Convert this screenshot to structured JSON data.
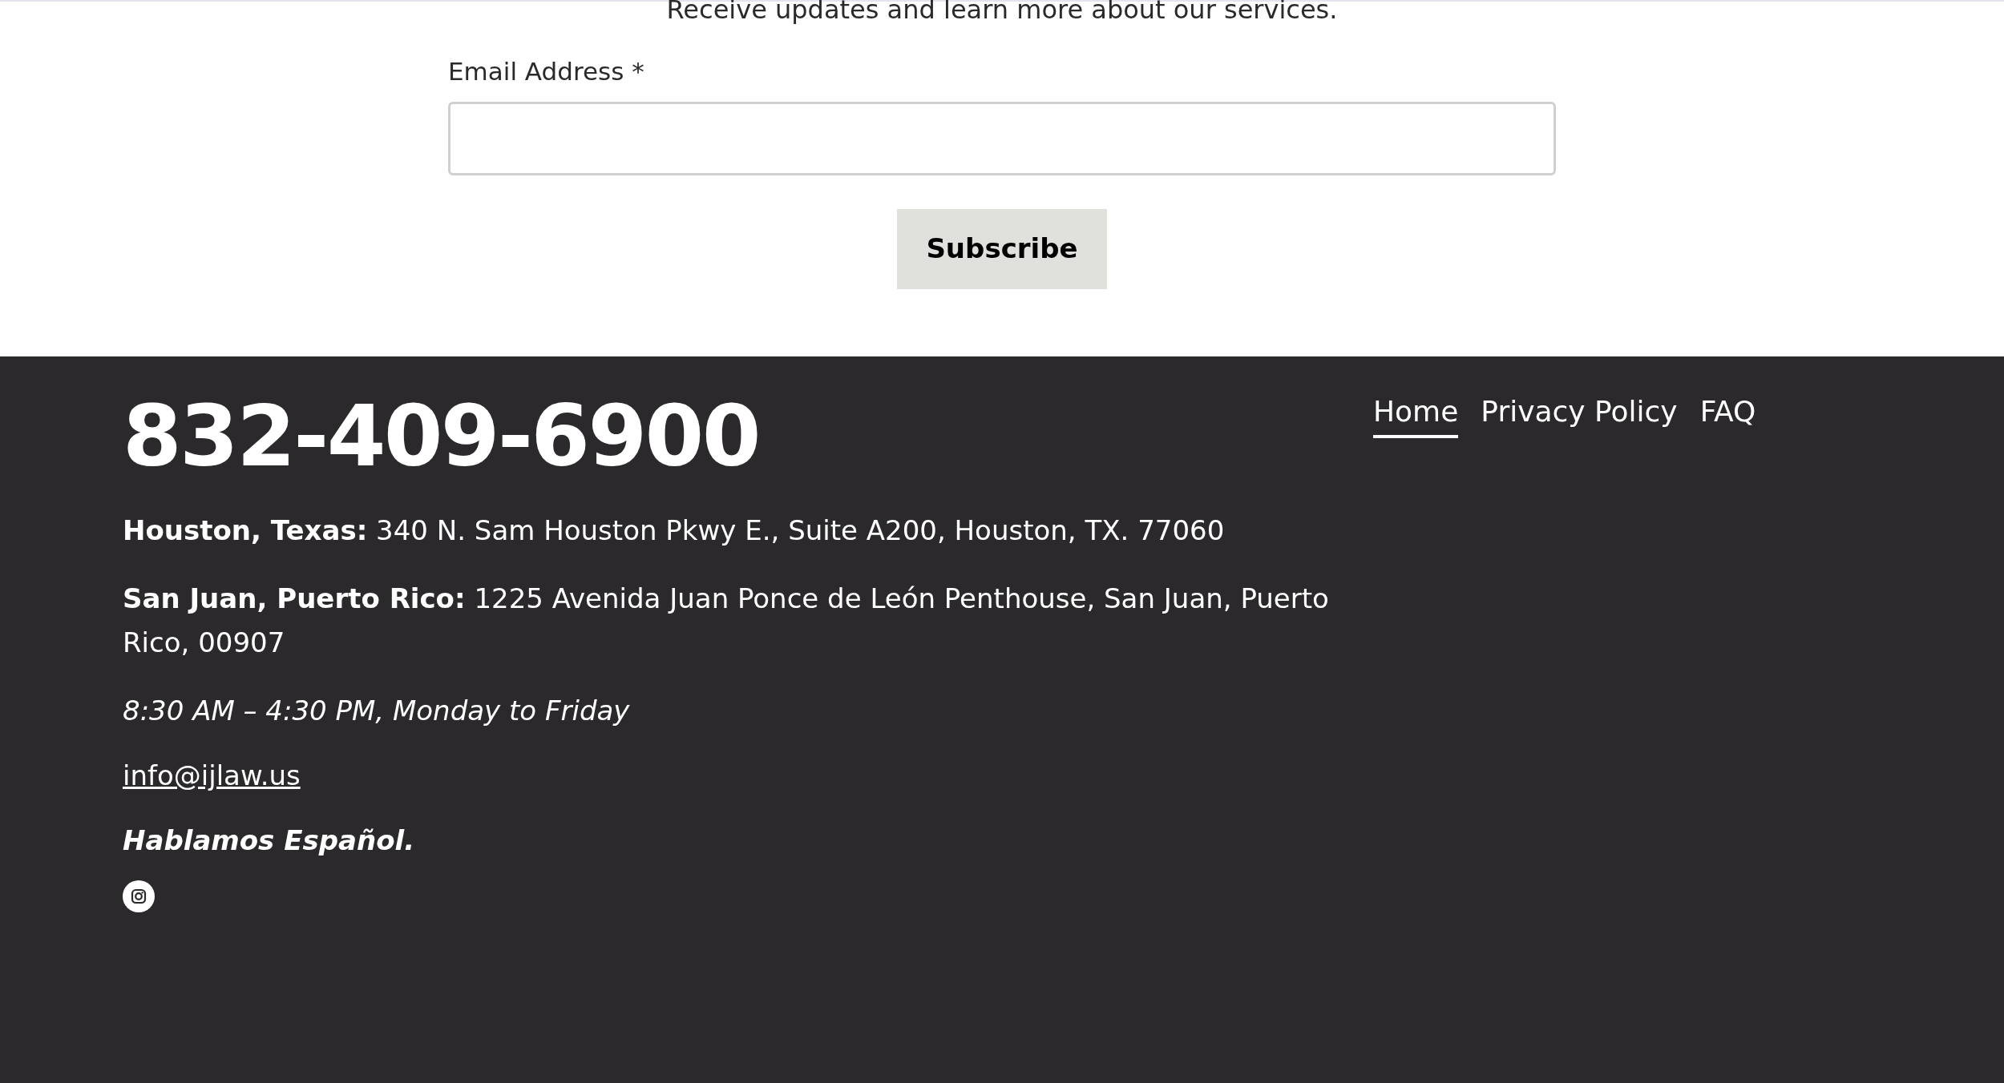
{
  "newsletter": {
    "intro": "Receive updates and learn more about our services.",
    "email_label": "Email Address *",
    "button": "Subscribe"
  },
  "footer": {
    "phone": "832-409-6900",
    "addresses": [
      "**Houston, Texas:** 340 N. Sam Houston Pkwy E., Suite A200, Houston, TX. 77060",
      "**San Juan, Puerto Rico:** 1225 Avenida Juan Ponce de León Penthouse, San Juan, Puerto Rico, 00907"
    ],
    "hours": "8:30 AM – 4:30 PM, Monday to Friday",
    "email": "info@ijlaw.us",
    "language_note": "Hablamos Español.",
    "nav": [
      {
        "label": "Home",
        "selected": true
      },
      {
        "label": "Privacy Policy",
        "selected": false
      },
      {
        "label": "FAQ",
        "selected": false
      }
    ]
  }
}
